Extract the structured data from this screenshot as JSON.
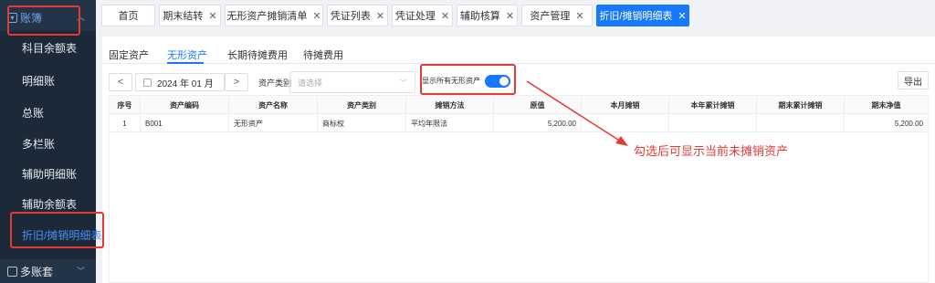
{
  "sidebar": {
    "section_label": "账簿",
    "items": [
      {
        "label": "科目余额表"
      },
      {
        "label": "明细账"
      },
      {
        "label": "总账"
      },
      {
        "label": "多栏账"
      },
      {
        "label": "辅助明细账"
      },
      {
        "label": "辅助余额表"
      },
      {
        "label": "折旧/摊销明细表"
      }
    ],
    "bottom_label": "多账套"
  },
  "tabs": [
    {
      "label": "首页"
    },
    {
      "label": "期末结转"
    },
    {
      "label": "无形资产摊销清单"
    },
    {
      "label": "凭证列表"
    },
    {
      "label": "凭证处理"
    },
    {
      "label": "辅助核算"
    },
    {
      "label": "资产管理"
    },
    {
      "label": "折旧/摊销明细表"
    }
  ],
  "subtabs": [
    {
      "label": "固定资产"
    },
    {
      "label": "无形资产"
    },
    {
      "label": "长期待摊费用"
    },
    {
      "label": "待摊费用"
    }
  ],
  "toolbar": {
    "prev": "<",
    "next": ">",
    "date": "2024 年 01 月",
    "category_label": "资产类别",
    "category_placeholder": "请选择",
    "toggle_label": "显示所有无形资产",
    "toggle_on": true,
    "export_label": "导出"
  },
  "table": {
    "headers": [
      "序号",
      "资产编码",
      "资产名称",
      "资产类别",
      "摊销方法",
      "原值",
      "本月摊销",
      "本年累计摊销",
      "期末累计摊销",
      "期末净值"
    ],
    "rows": [
      [
        "1",
        "B001",
        "无形资产",
        "商标权",
        "平均年限法",
        "5,200.00",
        "",
        "",
        "",
        "5,200.00"
      ]
    ]
  },
  "annotation": {
    "text": "勾选后可显示当前未摊销资产",
    "color": "#e53935"
  },
  "colors": {
    "accent": "#1677ff",
    "sidebar_bg": "#243447",
    "highlight": "#e53935"
  }
}
